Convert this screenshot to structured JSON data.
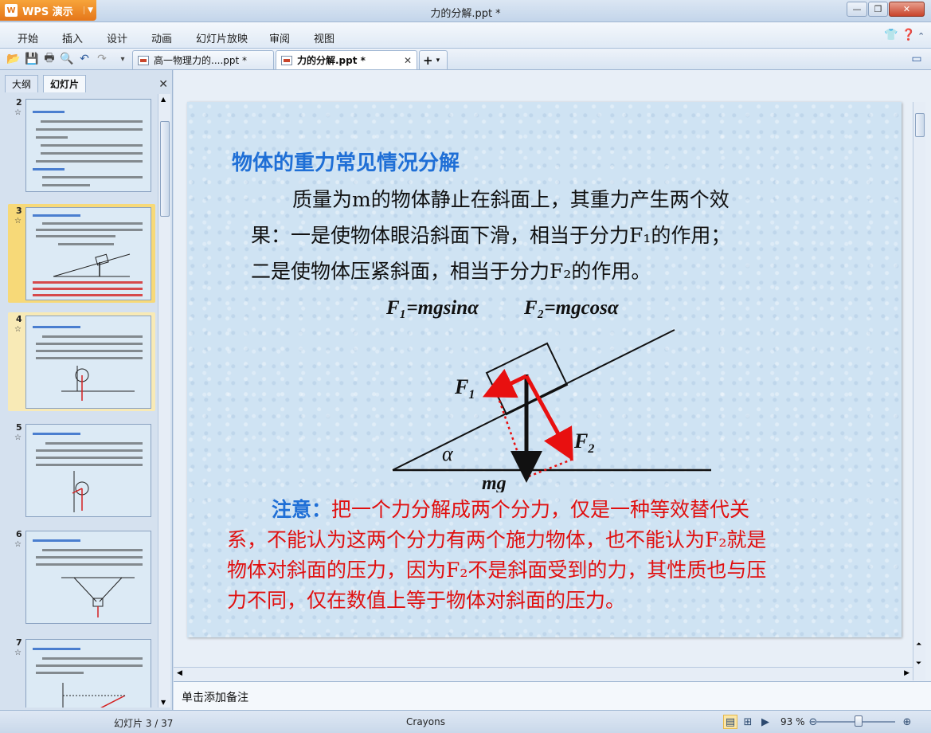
{
  "window": {
    "app_button": "WPS 演示",
    "title": "力的分解.ppt *"
  },
  "menu": [
    "开始",
    "插入",
    "设计",
    "动画",
    "幻灯片放映",
    "审阅",
    "视图"
  ],
  "tabs": [
    {
      "label": "高一物理力的....ppt *",
      "active": false
    },
    {
      "label": "力的分解.ppt *",
      "active": true
    }
  ],
  "left_panel": {
    "tab_outline": "大纲",
    "tab_slides": "幻灯片",
    "slides": [
      {
        "number": "2",
        "selected": false
      },
      {
        "number": "3",
        "selected": true
      },
      {
        "number": "4",
        "selected": false
      },
      {
        "number": "5",
        "selected": false
      },
      {
        "number": "6",
        "selected": false
      },
      {
        "number": "7",
        "selected": false
      }
    ]
  },
  "slide": {
    "title": "物体的重力常见情况分解",
    "para_line1": "质量为m的物体静止在斜面上，其重力产生两个效",
    "para_line2": "果：一是使物体眼沿斜面下滑，相当于分力F₁的作用；",
    "para_line3": "二是使物体压紧斜面，相当于分力F₂的作用。",
    "formula1": "F₁=mgsinα",
    "formula2": "F₂=mgcosα",
    "diagram": {
      "label_f1": "F",
      "label_f1_sub": "1",
      "label_f2": "F",
      "label_f2_sub": "2",
      "label_alpha": "α",
      "label_mg": "mg"
    },
    "note_label": "注意：",
    "note_text_1": "把一个力分解成两个分力，仅是一种等效替代关",
    "note_text_2": "系，不能认为这两个分力有两个施力物体，也不能认为F₂就是",
    "note_text_3": "物体对斜面的压力，因为F₂不是斜面受到的力，其性质也与压",
    "note_text_4": "力不同，仅在数值上等于物体对斜面的压力。"
  },
  "notes_placeholder": "单击添加备注",
  "status": {
    "slide_counter": "幻灯片 3 / 37",
    "theme": "Crayons",
    "zoom": "93 %"
  },
  "colors": {
    "title_blue": "#1f6fd6",
    "note_red": "#e01010",
    "arrow_red": "#e81010",
    "wps_orange": "#e5761a"
  }
}
